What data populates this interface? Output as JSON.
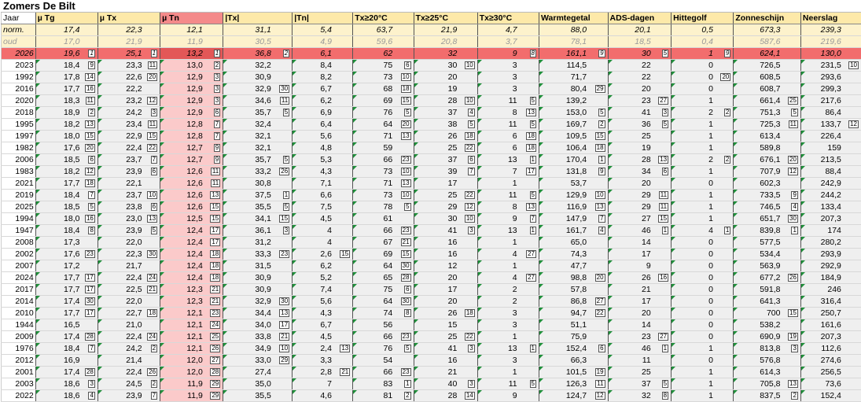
{
  "title": "Zomers De Bilt",
  "columns": [
    "Jaar",
    "µ Tg",
    "µ Tx",
    "µ Tn",
    "|Tx|",
    "|Tn|",
    "Tx≥20°C",
    "Tx≥25°C",
    "Tx≥30°C",
    "Warmtegetal",
    "ADS-dagen",
    "Hittegolf",
    "Zonneschijn",
    "Neerslag"
  ],
  "norm_row": {
    "label": "norm.",
    "values": [
      "17,4",
      "22,3",
      "12,1",
      "31,1",
      "5,4",
      "63,7",
      "21,9",
      "4,7",
      "88,0",
      "20,1",
      "0,5",
      "673,3",
      "239,3"
    ]
  },
  "oud_row": {
    "label": "oud",
    "values": [
      "17,0",
      "21,9",
      "11,9",
      "30,5",
      "4,9",
      "59,6",
      "20,8",
      "3,7",
      "78,1",
      "18,5",
      "0,4",
      "587,6",
      "219,6"
    ]
  },
  "current": {
    "year": "2026",
    "values": [
      "19,6",
      "25,1",
      "13,2",
      "36,8",
      "6,1",
      "62",
      "32",
      "9",
      "161,1",
      "30",
      "1",
      "624,1",
      "130,0"
    ],
    "ranks": [
      "1",
      "1",
      "1",
      "2",
      "",
      "",
      "",
      "8",
      "9",
      "5",
      "9",
      "",
      "",
      "1"
    ]
  },
  "rows": [
    {
      "year": "2023",
      "values": [
        "18,4",
        "23,3",
        "13,0",
        "32,2",
        "8,4",
        "75",
        "30",
        "3",
        "114,5",
        "22",
        "0",
        "726,5",
        "231,5"
      ],
      "ranks": [
        "9",
        "11",
        "2",
        "",
        "",
        "6",
        "10",
        "",
        "",
        "",
        "",
        "",
        "10",
        ""
      ]
    },
    {
      "year": "1992",
      "values": [
        "17,8",
        "22,6",
        "12,9",
        "30,9",
        "8,2",
        "73",
        "20",
        "3",
        "71,7",
        "22",
        "0",
        "608,5",
        "293,6"
      ],
      "ranks": [
        "14",
        "20",
        "3",
        "",
        "",
        "10",
        "",
        "",
        "",
        "",
        "20",
        "",
        "",
        ""
      ]
    },
    {
      "year": "2016",
      "values": [
        "17,7",
        "22,2",
        "12,9",
        "32,9",
        "6,7",
        "68",
        "19",
        "3",
        "80,4",
        "20",
        "0",
        "608,7",
        "299,3"
      ],
      "ranks": [
        "16",
        "",
        "3",
        "30",
        "",
        "18",
        "",
        "",
        "29",
        "",
        "",
        "",
        "",
        ""
      ]
    },
    {
      "year": "2020",
      "values": [
        "18,3",
        "23,2",
        "12,9",
        "34,6",
        "6,2",
        "69",
        "28",
        "11",
        "139,2",
        "23",
        "1",
        "661,4",
        "217,6"
      ],
      "ranks": [
        "11",
        "12",
        "3",
        "11",
        "",
        "15",
        "10",
        "5",
        "",
        "27",
        "",
        "25",
        "",
        ""
      ]
    },
    {
      "year": "2018",
      "values": [
        "18,9",
        "24,2",
        "12,9",
        "35,7",
        "6,9",
        "76",
        "37",
        "8",
        "153,0",
        "41",
        "2",
        "751,3",
        "86,4"
      ],
      "ranks": [
        "2",
        "3",
        "6",
        "5",
        "",
        "5",
        "4",
        "13",
        "5",
        "3",
        "2",
        "5",
        "",
        "3"
      ]
    },
    {
      "year": "1995",
      "values": [
        "18,2",
        "23,4",
        "12,8",
        "32,4",
        "6,4",
        "64",
        "38",
        "11",
        "169,7",
        "36",
        "1",
        "725,3",
        "133,7"
      ],
      "ranks": [
        "13",
        "11",
        "7",
        "",
        "",
        "20",
        "5",
        "5",
        "2",
        "5",
        "",
        "11",
        "12",
        ""
      ]
    },
    {
      "year": "1997",
      "values": [
        "18,0",
        "22,9",
        "12,8",
        "32,1",
        "5,6",
        "71",
        "26",
        "6",
        "109,5",
        "25",
        "1",
        "613,4",
        "226,4"
      ],
      "ranks": [
        "15",
        "15",
        "7",
        "",
        "",
        "13",
        "18",
        "18",
        "15",
        "",
        "",
        "",
        "",
        ""
      ]
    },
    {
      "year": "1982",
      "values": [
        "17,6",
        "22,4",
        "12,7",
        "32,1",
        "4,8",
        "59",
        "25",
        "6",
        "106,4",
        "19",
        "1",
        "589,8",
        "159"
      ],
      "ranks": [
        "20",
        "22",
        "9",
        "",
        "",
        "",
        "22",
        "18",
        "18",
        "",
        "",
        "",
        "",
        "24"
      ]
    },
    {
      "year": "2006",
      "values": [
        "18,5",
        "23,7",
        "12,7",
        "35,7",
        "5,3",
        "66",
        "37",
        "13",
        "170,4",
        "28",
        "2",
        "676,1",
        "213,5"
      ],
      "ranks": [
        "6",
        "7",
        "9",
        "5",
        "",
        "23",
        "6",
        "1",
        "1",
        "13",
        "2",
        "20",
        "",
        ""
      ]
    },
    {
      "year": "1983",
      "values": [
        "18,2",
        "23,9",
        "12,6",
        "33,2",
        "4,3",
        "73",
        "39",
        "7",
        "131,8",
        "34",
        "1",
        "707,9",
        "88,4"
      ],
      "ranks": [
        "12",
        "6",
        "11",
        "26",
        "",
        "10",
        "7",
        "17",
        "9",
        "6",
        "",
        "12",
        "",
        "4"
      ]
    },
    {
      "year": "2021",
      "values": [
        "17,7",
        "22,1",
        "12,6",
        "30,8",
        "7,1",
        "71",
        "17",
        "1",
        "53,7",
        "20",
        "0",
        "602,3",
        "242,9"
      ],
      "ranks": [
        "18",
        "",
        "11",
        "",
        "",
        "13",
        "",
        "",
        "",
        "",
        "",
        "",
        "",
        ""
      ]
    },
    {
      "year": "2019",
      "values": [
        "18,4",
        "23,7",
        "12,6",
        "37,5",
        "6,6",
        "73",
        "25",
        "11",
        "129,9",
        "29",
        "1",
        "733,5",
        "244,2"
      ],
      "ranks": [
        "7",
        "10",
        "13",
        "1",
        "",
        "10",
        "22",
        "5",
        "10",
        "11",
        "",
        "9",
        "",
        ""
      ]
    },
    {
      "year": "2025",
      "values": [
        "18,5",
        "23,8",
        "12,6",
        "35,5",
        "7,5",
        "78",
        "29",
        "8",
        "116,9",
        "29",
        "1",
        "746,5",
        "133,4"
      ],
      "ranks": [
        "5",
        "6",
        "15",
        "5",
        "",
        "5",
        "12",
        "13",
        "13",
        "11",
        "",
        "4",
        "",
        "11"
      ]
    },
    {
      "year": "1994",
      "values": [
        "18,0",
        "23,0",
        "12,5",
        "34,1",
        "4,5",
        "61",
        "30",
        "9",
        "147,9",
        "27",
        "1",
        "651,7",
        "207,3"
      ],
      "ranks": [
        "16",
        "13",
        "15",
        "15",
        "",
        "",
        "10",
        "7",
        "7",
        "15",
        "",
        "30",
        "",
        ""
      ]
    },
    {
      "year": "1947",
      "values": [
        "18,4",
        "23,9",
        "12,4",
        "36,1",
        "4",
        "66",
        "41",
        "13",
        "161,7",
        "46",
        "4",
        "839,8",
        "174"
      ],
      "ranks": [
        "8",
        "5",
        "17",
        "3",
        "",
        "23",
        "3",
        "1",
        "4",
        "1",
        "1",
        "1",
        "",
        ""
      ]
    },
    {
      "year": "2008",
      "values": [
        "17,3",
        "22,0",
        "12,4",
        "31,2",
        "4",
        "67",
        "16",
        "1",
        "65,0",
        "14",
        "0",
        "577,5",
        "280,2"
      ],
      "ranks": [
        "",
        "",
        "17",
        "",
        "",
        "21",
        "",
        "",
        "",
        "",
        "",
        "",
        "",
        ""
      ]
    },
    {
      "year": "2002",
      "values": [
        "17,6",
        "22,3",
        "12,4",
        "33,3",
        "2,6",
        "69",
        "16",
        "4",
        "74,3",
        "17",
        "0",
        "534,4",
        "293,9"
      ],
      "ranks": [
        "23",
        "30",
        "18",
        "23",
        "15",
        "15",
        "",
        "27",
        "",
        "",
        "",
        "",
        "",
        ""
      ]
    },
    {
      "year": "2007",
      "values": [
        "17,2",
        "21,7",
        "12,4",
        "31,5",
        "6,2",
        "64",
        "12",
        "1",
        "47,7",
        "9",
        "0",
        "563,9",
        "292,9"
      ],
      "ranks": [
        "",
        "",
        "18",
        "",
        "",
        "30",
        "",
        "",
        "",
        "",
        "",
        "",
        "",
        ""
      ]
    },
    {
      "year": "2024",
      "values": [
        "17,7",
        "22,4",
        "12,4",
        "30,9",
        "5,2",
        "65",
        "20",
        "4",
        "98,8",
        "26",
        "0",
        "677,2",
        "184,9"
      ],
      "ranks": [
        "17",
        "24",
        "18",
        "",
        "",
        "28",
        "",
        "27",
        "20",
        "16",
        "",
        "26",
        "",
        ""
      ]
    },
    {
      "year": "2017",
      "values": [
        "17,7",
        "22,5",
        "12,3",
        "30,9",
        "7,4",
        "75",
        "17",
        "2",
        "57,8",
        "21",
        "0",
        "591,8",
        "246"
      ],
      "ranks": [
        "17",
        "21",
        "21",
        "",
        "",
        "6",
        "",
        "",
        "",
        "",
        "",
        "",
        "",
        ""
      ]
    },
    {
      "year": "2014",
      "values": [
        "17,4",
        "22,0",
        "12,3",
        "32,9",
        "5,6",
        "64",
        "20",
        "2",
        "86,8",
        "17",
        "0",
        "641,3",
        "316,4"
      ],
      "ranks": [
        "30",
        "",
        "21",
        "30",
        "",
        "30",
        "",
        "",
        "27",
        "",
        "",
        "",
        "",
        ""
      ]
    },
    {
      "year": "2010",
      "values": [
        "17,7",
        "22,7",
        "12,1",
        "34,4",
        "4,3",
        "74",
        "26",
        "3",
        "94,7",
        "20",
        "0",
        "700",
        "250,7"
      ],
      "ranks": [
        "17",
        "18",
        "23",
        "13",
        "",
        "8",
        "18",
        "",
        "22",
        "",
        "",
        "15",
        "",
        ""
      ]
    },
    {
      "year": "1944",
      "values": [
        "16,5",
        "21,0",
        "12,1",
        "34,0",
        "6,7",
        "56",
        "15",
        "3",
        "51,1",
        "14",
        "0",
        "538,2",
        "161,6"
      ],
      "ranks": [
        "",
        "",
        "24",
        "17",
        "",
        "",
        "",
        "",
        "",
        "",
        "",
        "",
        "",
        "26"
      ]
    },
    {
      "year": "2009",
      "values": [
        "17,4",
        "22,4",
        "12,1",
        "33,8",
        "4,5",
        "66",
        "25",
        "1",
        "75,9",
        "23",
        "0",
        "690,9",
        "207,3"
      ],
      "ranks": [
        "28",
        "24",
        "25",
        "21",
        "",
        "23",
        "22",
        "",
        "",
        "27",
        "",
        "19",
        "",
        ""
      ]
    },
    {
      "year": "1976",
      "values": [
        "18,4",
        "24,2",
        "12,1",
        "34,9",
        "2,4",
        "76",
        "41",
        "13",
        "152,4",
        "46",
        "1",
        "813,8",
        "112,6"
      ],
      "ranks": [
        "7",
        "2",
        "26",
        "10",
        "13",
        "5",
        "3",
        "1",
        "6",
        "1",
        "",
        "3",
        "",
        "7"
      ]
    },
    {
      "year": "2012",
      "values": [
        "16,9",
        "21,4",
        "12,0",
        "33,0",
        "3,3",
        "54",
        "16",
        "3",
        "66,3",
        "11",
        "0",
        "576,8",
        "274,6"
      ],
      "ranks": [
        "",
        "",
        "27",
        "29",
        "",
        "",
        "",
        "",
        "",
        "",
        "",
        "",
        "",
        ""
      ]
    },
    {
      "year": "2001",
      "values": [
        "17,4",
        "22,4",
        "12,0",
        "27,4",
        "2,8",
        "66",
        "21",
        "1",
        "101,5",
        "25",
        "1",
        "614,3",
        "256,5"
      ],
      "ranks": [
        "28",
        "26",
        "28",
        "",
        "21",
        "23",
        "",
        "",
        "19",
        "",
        "",
        "",
        "",
        ""
      ]
    },
    {
      "year": "2003",
      "values": [
        "18,6",
        "24,5",
        "11,9",
        "35,0",
        "7",
        "83",
        "40",
        "11",
        "126,3",
        "37",
        "1",
        "705,8",
        "73,6"
      ],
      "ranks": [
        "3",
        "2",
        "29",
        "",
        "",
        "1",
        "3",
        "5",
        "11",
        "5",
        "",
        "13",
        "",
        "1"
      ]
    },
    {
      "year": "2022",
      "values": [
        "18,6",
        "23,9",
        "11,9",
        "35,5",
        "4,6",
        "81",
        "28",
        "9",
        "124,7",
        "32",
        "1",
        "837,5",
        "152,4"
      ],
      "ranks": [
        "4",
        "7",
        "29",
        "",
        "",
        "2",
        "14",
        "",
        "12",
        "8",
        "",
        "2",
        "",
        "24"
      ]
    }
  ],
  "colors": {
    "header": "#fde9a9",
    "hot_header": "#f48a8a",
    "hot_col": "#fbcaca",
    "current": "#f26d6d",
    "marker": "#1f8f3a"
  }
}
